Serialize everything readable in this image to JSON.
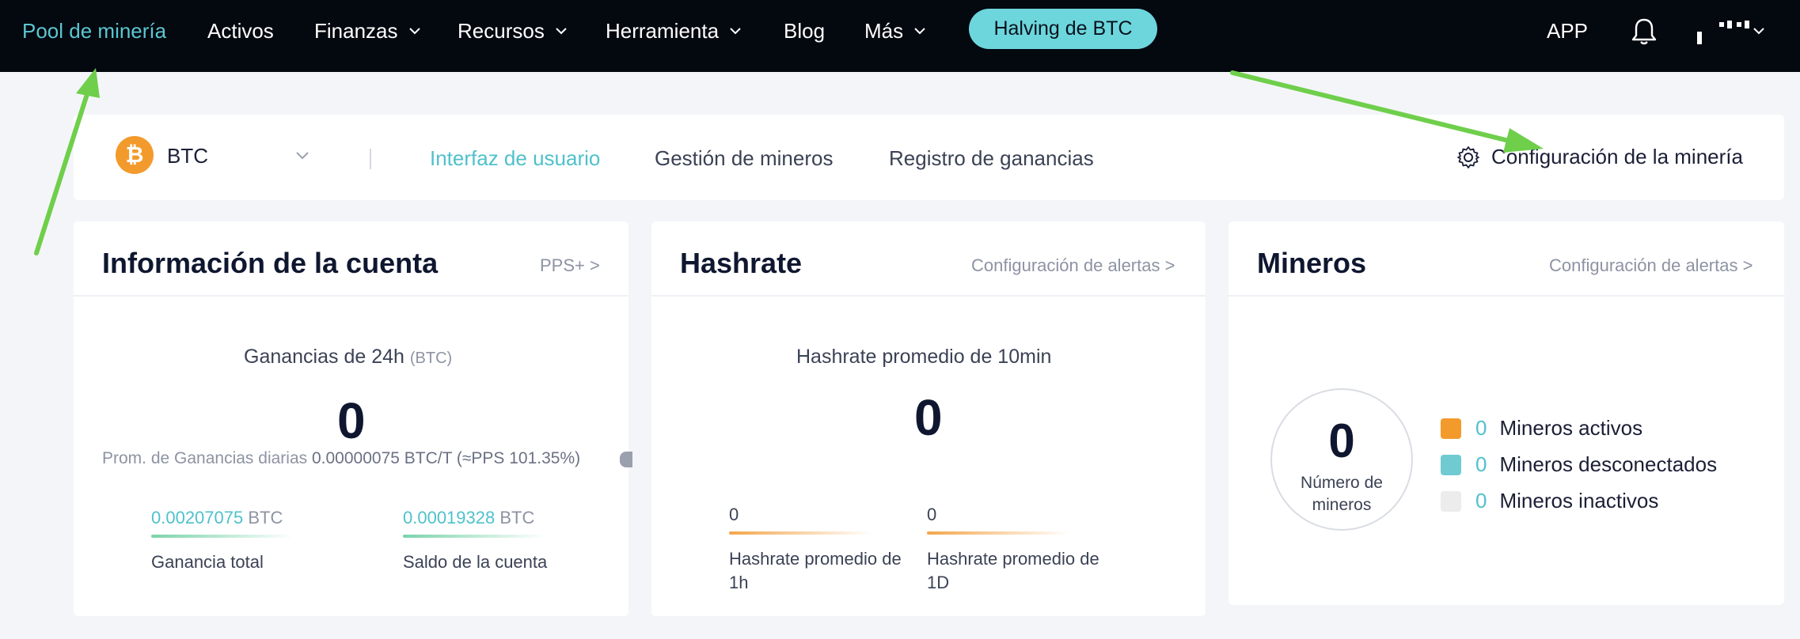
{
  "nav": {
    "logo": "Pool de minería",
    "items": [
      {
        "label": "Activos",
        "dropdown": false
      },
      {
        "label": "Finanzas",
        "dropdown": true
      },
      {
        "label": "Recursos",
        "dropdown": true
      },
      {
        "label": "Herramienta",
        "dropdown": true
      },
      {
        "label": "Blog",
        "dropdown": false
      },
      {
        "label": "Más",
        "dropdown": true
      }
    ],
    "halving": "Halving de BTC",
    "app": "APP"
  },
  "subbar": {
    "coin_icon": "bitcoin-icon",
    "coin": "BTC",
    "tabs": [
      "Interfaz de usuario",
      "Gestión de mineros",
      "Registro de ganancias"
    ],
    "active_tab": "Interfaz de usuario",
    "settings": "Configuración de la minería"
  },
  "account": {
    "title": "Información de la cuenta",
    "link": "PPS+ >",
    "earnings_label": "Ganancias de 24h",
    "earnings_unit": "(BTC)",
    "earnings_value": "0",
    "prom_label": "Prom. de Ganancias diarias",
    "prom_value": "0.00000075 BTC/T (≈PPS 101.35%)",
    "total_value": "0.00207075",
    "total_unit": "BTC",
    "total_label": "Ganancia total",
    "balance_value": "0.00019328",
    "balance_unit": "BTC",
    "balance_label": "Saldo de la cuenta"
  },
  "hashrate": {
    "title": "Hashrate",
    "link": "Configuración de alertas >",
    "avg10_label": "Hashrate promedio de 10min",
    "avg10_value": "0",
    "h1_value": "0",
    "h1_label": "Hashrate promedio de 1h",
    "d1_value": "0",
    "d1_label": "Hashrate promedio de 1D"
  },
  "miners": {
    "title": "Mineros",
    "link": "Configuración de alertas >",
    "count": "0",
    "count_label": "Número de mineros",
    "legend": [
      {
        "count": "0",
        "label": "Mineros activos",
        "color": "#f39a2c"
      },
      {
        "count": "0",
        "label": "Mineros desconectados",
        "color": "#6fcbd1"
      },
      {
        "count": "0",
        "label": "Mineros inactivos",
        "color": "#ececec"
      }
    ]
  },
  "colors": {
    "accent": "#4fc1cc",
    "nav_bg": "#04080f",
    "annotation_arrow": "#6fcf4b"
  }
}
